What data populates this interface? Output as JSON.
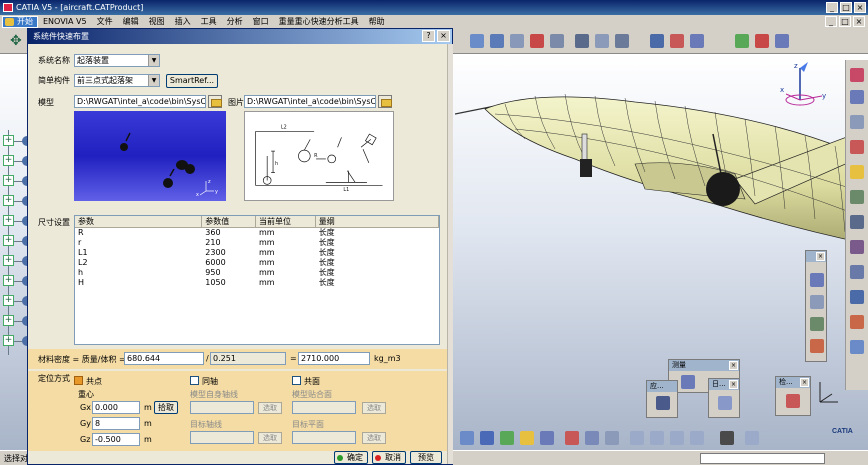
{
  "window": {
    "title": "CATIA V5 - [aircraft.CATProduct]"
  },
  "menubar": {
    "start": "开始",
    "items": [
      "ENOVIA V5",
      "文件",
      "编辑",
      "视图",
      "插入",
      "工具",
      "分析",
      "窗口",
      "重量重心快速分析工具",
      "帮助"
    ]
  },
  "dialog": {
    "title": "系统件快速布置",
    "system_name_label": "系统名称",
    "system_name_value": "起落装置",
    "component_label": "简单构件",
    "component_value": "前三点式起落架",
    "smartref_label": "SmartRef...",
    "model_label": "模型",
    "model_path": "D:\\RWGAT\\intel_a\\code\\bin\\SysCon",
    "picture_label": "图片",
    "picture_path": "D:\\RWGAT\\intel_a\\code\\bin\\SysCon",
    "size_label": "尺寸设置",
    "table": {
      "headers": [
        "参数",
        "参数值",
        "当前单位",
        "量纲"
      ],
      "rows": [
        [
          "R",
          "360",
          "mm",
          "长度"
        ],
        [
          "r",
          "210",
          "mm",
          "长度"
        ],
        [
          "L1",
          "2300",
          "mm",
          "长度"
        ],
        [
          "L2",
          "6000",
          "mm",
          "长度"
        ],
        [
          "h",
          "950",
          "mm",
          "长度"
        ],
        [
          "H",
          "1050",
          "mm",
          "长度"
        ]
      ]
    },
    "material": {
      "label": "材料密度 = 质量/体积 =",
      "mass": "680.644",
      "slash": "/",
      "volume": "0.251",
      "equals": "=",
      "density": "2710.000",
      "unit": "kg_m3"
    },
    "position": {
      "label": "定位方式",
      "opt_point": "共点",
      "opt_axis": "同轴",
      "opt_plane": "共面",
      "center_label": "重心",
      "gx_label": "Gx",
      "gx_value": "0.000",
      "gy_label": "Gy",
      "gy_value": "8",
      "gz_label": "Gz",
      "gz_value": "-0.500",
      "unit_m": "m",
      "pick_label": "拾取",
      "model_axis_label": "模型自身轴线",
      "target_axis_label": "目标轴线",
      "model_plane_label": "模型贴合面",
      "target_plane_label": "目标平面",
      "select_label": "选取"
    },
    "footer": {
      "ok": "确定",
      "cancel": "取消",
      "preview": "预览"
    },
    "pic_labels": {
      "l2": "L2",
      "l1": "L1",
      "r": "R",
      "h": "h"
    }
  },
  "float_toolbars": {
    "measure_title": "测量",
    "tb2_title": "日...",
    "tb3_title": "应...",
    "tb4_title": "检..."
  },
  "status": {
    "text": "选择对象"
  },
  "logo": "CATIA",
  "axis": {
    "x": "x",
    "y": "y",
    "z": "z"
  }
}
